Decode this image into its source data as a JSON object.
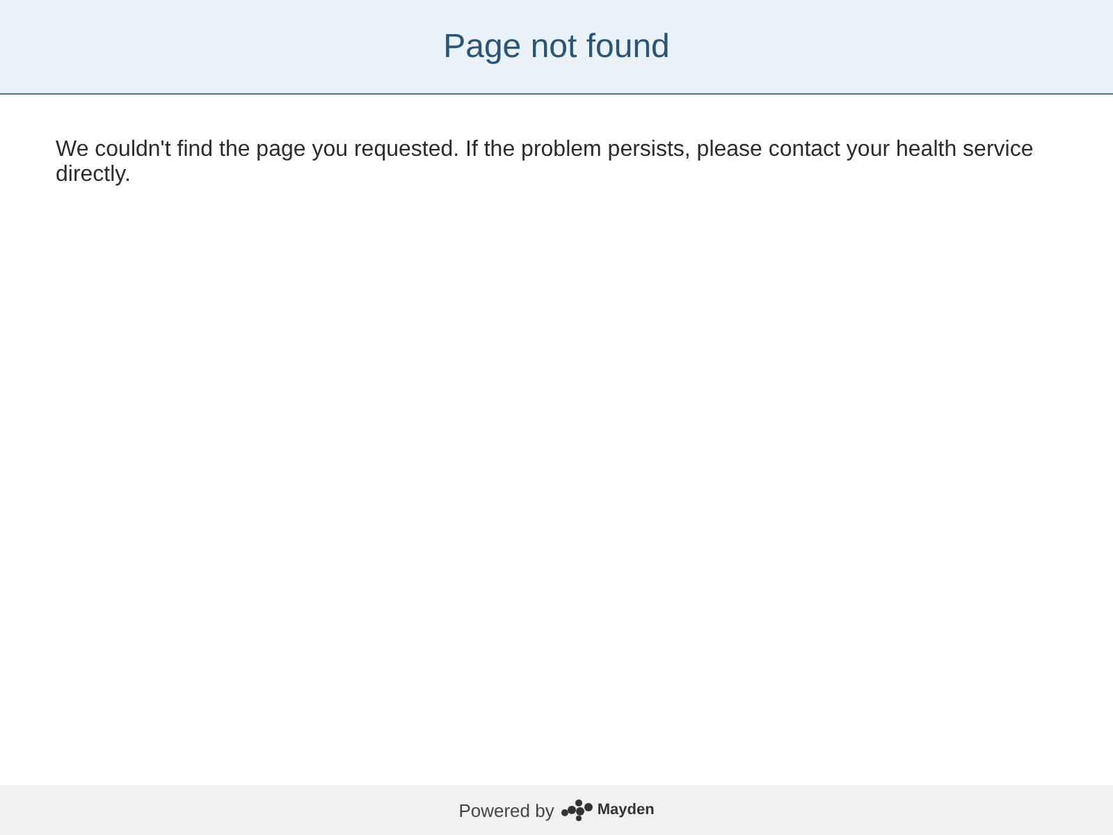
{
  "header": {
    "title": "Page not found"
  },
  "message": "We couldn't find the page you requested. If the problem persists, please contact your health service directly.",
  "footer": {
    "powered_by": "Powered by",
    "brand": "Mayden"
  }
}
